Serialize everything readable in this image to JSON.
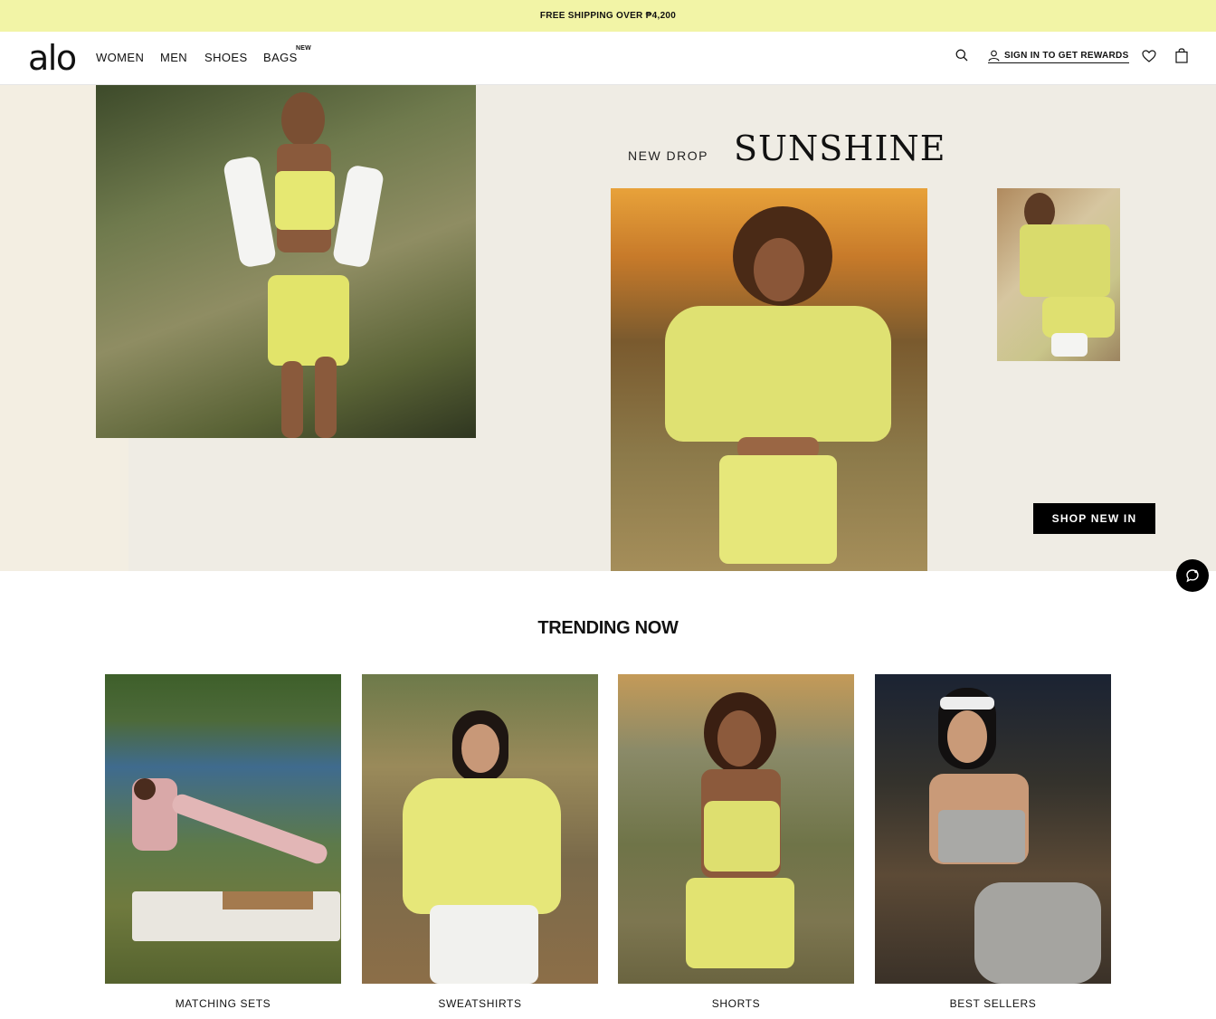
{
  "promo": {
    "text": "FREE SHIPPING OVER ₱4,200"
  },
  "header": {
    "logo": "alo",
    "nav": [
      {
        "label": "WOMEN"
      },
      {
        "label": "MEN"
      },
      {
        "label": "SHOES"
      },
      {
        "label": "BAGS",
        "badge": "NEW"
      }
    ],
    "account_label": "SIGN IN TO GET REWARDS",
    "icons": [
      "search-icon",
      "user-icon",
      "heart-icon",
      "bag-icon"
    ]
  },
  "hero": {
    "kicker": "NEW DROP",
    "title": "SUNSHINE",
    "cta": "SHOP NEW IN"
  },
  "trending": {
    "title": "TRENDING NOW",
    "cards": [
      {
        "label": "MATCHING SETS"
      },
      {
        "label": "SWEATSHIRTS"
      },
      {
        "label": "SHORTS"
      },
      {
        "label": "BEST SELLERS"
      }
    ]
  },
  "chat": {
    "icon": "chat-icon"
  }
}
